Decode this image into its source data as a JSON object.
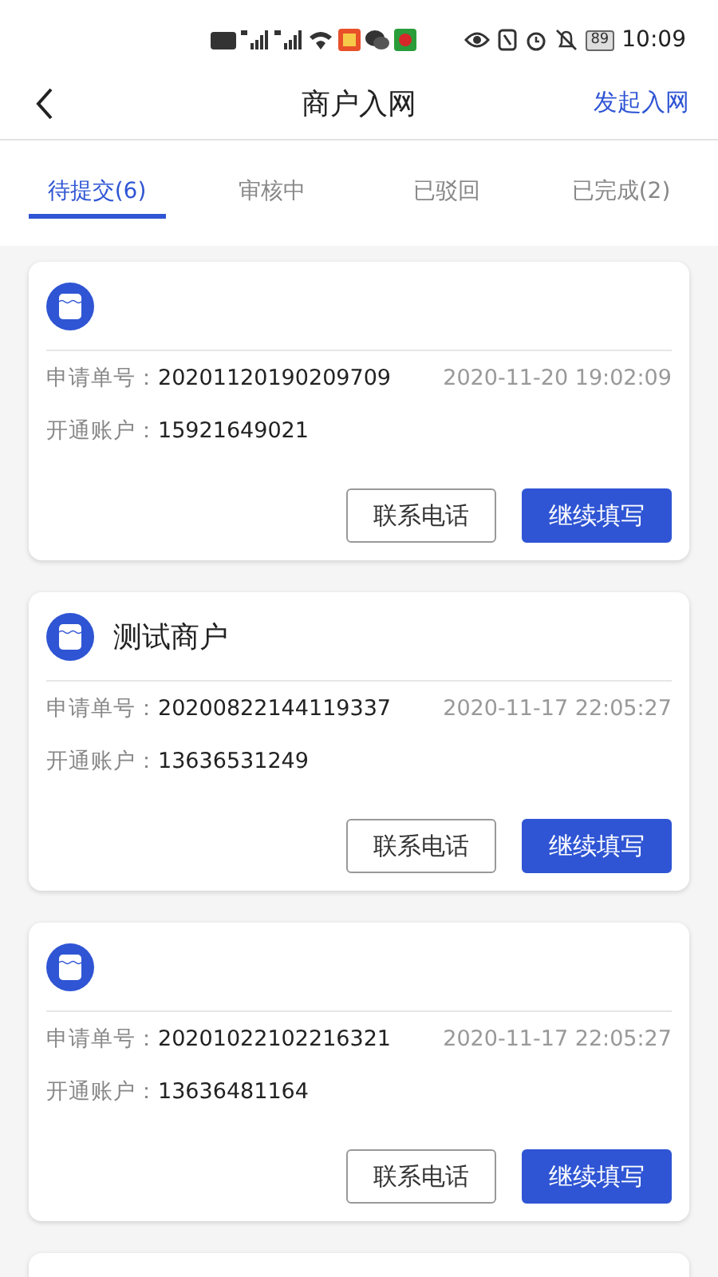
{
  "status_bar": {
    "battery": "89",
    "time": "10:09"
  },
  "header": {
    "title": "商户入网",
    "action": "发起入网"
  },
  "tabs": [
    {
      "label": "待提交(6)",
      "selected": true
    },
    {
      "label": "审核中",
      "selected": false
    },
    {
      "label": "已驳回",
      "selected": false
    },
    {
      "label": "已完成(2)",
      "selected": false
    }
  ],
  "cards": [
    {
      "kind": "full",
      "order_label": "申请单号：",
      "order_no": "20201120190209709",
      "time": "2020-11-20 19:02:09",
      "account_label": "开通账户：",
      "account": "15921649021",
      "buttons": [
        {
          "label": "联系电话",
          "kind": "outline"
        },
        {
          "label": "继续填写",
          "kind": "primary"
        }
      ]
    },
    {
      "kind": "full",
      "name": "测试商户",
      "order_label": "申请单号：",
      "order_no": "20200822144119337",
      "time": "2020-11-17 22:05:27",
      "account_label": "开通账户：",
      "account": "13636531249",
      "buttons": [
        {
          "label": "联系电话",
          "kind": "outline"
        },
        {
          "label": "继续填写",
          "kind": "primary"
        }
      ]
    },
    {
      "kind": "full",
      "order_label": "申请单号：",
      "order_no": "20201022102216321",
      "time": "2020-11-17 22:05:27",
      "account_label": "开通账户：",
      "account": "13636481164",
      "buttons": [
        {
          "label": "联系电话",
          "kind": "outline"
        },
        {
          "label": "继续填写",
          "kind": "primary"
        }
      ]
    },
    {
      "kind": "partial"
    }
  ]
}
